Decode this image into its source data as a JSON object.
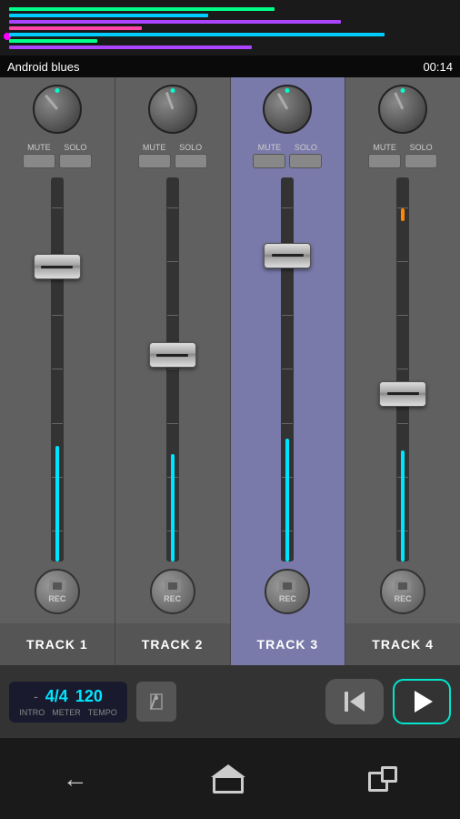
{
  "waveform": {
    "bars": [
      {
        "color": "#00ff88",
        "width": "60%"
      },
      {
        "color": "#00ccff",
        "width": "45%"
      },
      {
        "color": "#aa44ff",
        "width": "75%"
      },
      {
        "color": "#ff44aa",
        "width": "30%"
      },
      {
        "color": "#00ccff",
        "width": "85%"
      },
      {
        "color": "#00ff88",
        "width": "20%"
      },
      {
        "color": "#aa44ff",
        "width": "55%"
      }
    ],
    "songTitle": "Android blues",
    "songTime": "00:14"
  },
  "tracks": [
    {
      "id": "track1",
      "label": "TRACK 1",
      "selected": false,
      "knobAngle": -40,
      "knobDotColor": "#00ffcc",
      "faderPosition": 0.2,
      "levelColor": "#00e5ff",
      "levelHeight": "30%",
      "hasOrangeMark": false
    },
    {
      "id": "track2",
      "label": "TRACK 2",
      "selected": false,
      "knobAngle": -20,
      "knobDotColor": "#00ffcc",
      "faderPosition": 0.45,
      "levelColor": "#00e5ff",
      "levelHeight": "28%",
      "hasOrangeMark": false
    },
    {
      "id": "track3",
      "label": "TRACK 3",
      "selected": true,
      "knobAngle": -30,
      "knobDotColor": "#00ffcc",
      "faderPosition": 0.18,
      "levelColor": "#00e5ff",
      "levelHeight": "32%",
      "hasOrangeMark": false
    },
    {
      "id": "track4",
      "label": "TRACK 4",
      "selected": false,
      "knobAngle": -25,
      "knobDotColor": "#00ffcc",
      "faderPosition": 0.55,
      "levelColor": "#00e5ff",
      "levelHeight": "29%",
      "hasOrangeMark": true
    }
  ],
  "buttons": {
    "mute": "MUTE",
    "solo": "SOLO",
    "rec": "REC"
  },
  "tempo": {
    "dash": "-",
    "meter": "4/4",
    "bpm": "120",
    "labels": [
      "INTRO",
      "METER",
      "TEMPO"
    ]
  },
  "transport": {
    "rewindLabel": "rewind",
    "playLabel": "play"
  },
  "nav": {
    "back": "←",
    "home": "home",
    "recent": "recent"
  }
}
